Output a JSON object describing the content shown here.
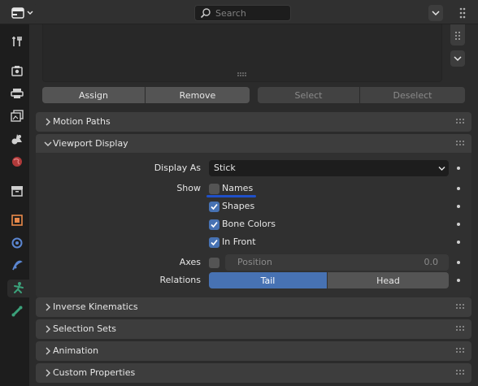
{
  "search": {
    "placeholder": "Search"
  },
  "vertex_groups": {
    "assign": "Assign",
    "remove": "Remove",
    "select": "Select",
    "deselect": "Deselect"
  },
  "panels": {
    "motion_paths": "Motion Paths",
    "viewport_display": "Viewport Display",
    "inverse_kinematics": "Inverse Kinematics",
    "selection_sets": "Selection Sets",
    "animation": "Animation",
    "custom_properties": "Custom Properties"
  },
  "viewport": {
    "display_as_label": "Display As",
    "display_as_value": "Stick",
    "show_label": "Show",
    "names": {
      "label": "Names",
      "checked": false
    },
    "shapes": {
      "label": "Shapes",
      "checked": true
    },
    "bone_colors": {
      "label": "Bone Colors",
      "checked": true
    },
    "in_front": {
      "label": "In Front",
      "checked": true
    },
    "axes_label": "Axes",
    "axes_position_label": "Position",
    "axes_position_value": "0.0",
    "relations_label": "Relations",
    "relations_tail": "Tail",
    "relations_head": "Head",
    "relations_selected": "Tail"
  },
  "icons": [
    "editor-type-icon",
    "search-icon",
    "options-icon",
    "tool-icon",
    "render-icon",
    "output-icon",
    "view-layer-icon",
    "scene-icon",
    "world-icon",
    "collection-icon",
    "object-icon",
    "modifier-icon",
    "particles-icon",
    "physics-icon",
    "object-data-armature-icon",
    "bone-icon"
  ],
  "colors": {
    "accent": "#4772b3",
    "active_tab_icon": "#3ba17a",
    "annotation_underline": "#1f50c9"
  }
}
